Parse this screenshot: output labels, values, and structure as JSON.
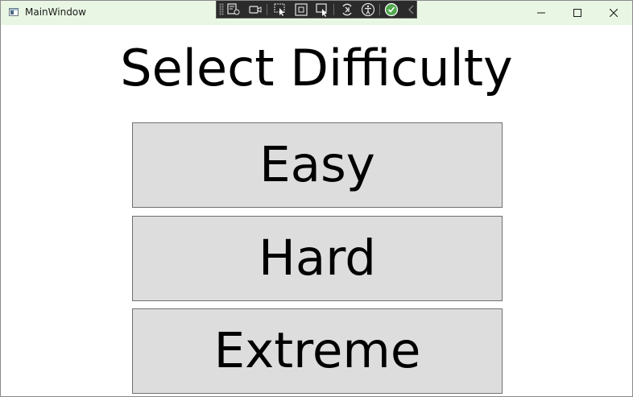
{
  "window": {
    "title": "MainWindow",
    "titlebar_color": "#e9f6e3"
  },
  "debug_toolbar": {
    "icons": [
      "live-visual-tree-icon",
      "record-icon",
      "select-element-icon",
      "display-layout-adorners-icon",
      "track-focus-icon",
      "hot-reload-icon",
      "accessibility-icon",
      "binding-check-icon",
      "collapse-chevron-icon"
    ]
  },
  "window_controls": {
    "icons": [
      "minimize-icon",
      "maximize-icon",
      "close-icon"
    ]
  },
  "main": {
    "heading": "Select Difficulty",
    "buttons": [
      {
        "label": "Easy"
      },
      {
        "label": "Hard"
      },
      {
        "label": "Extreme"
      }
    ],
    "button_color": "#dddddd"
  }
}
